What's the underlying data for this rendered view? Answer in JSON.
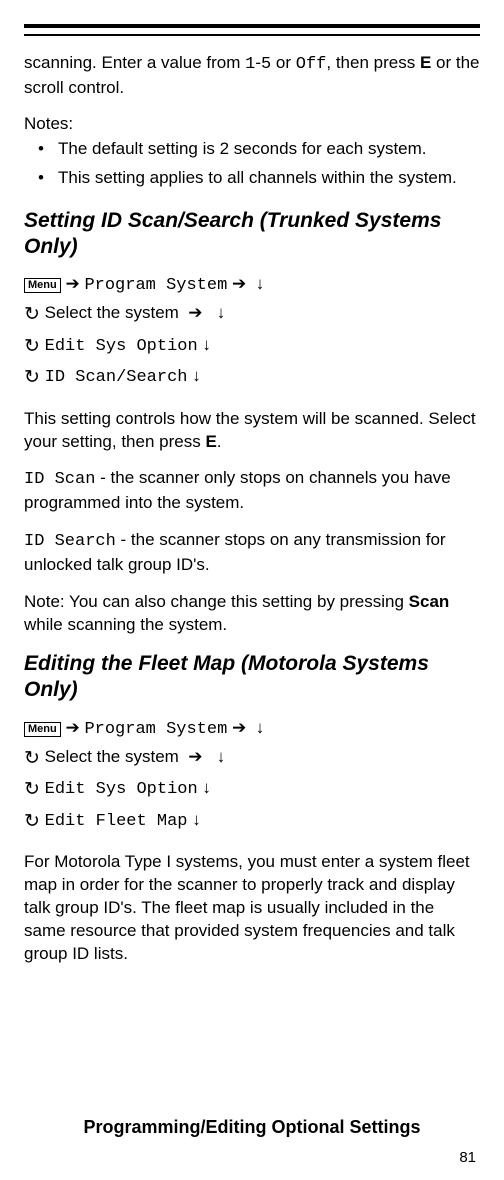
{
  "intro": {
    "p1_a": "scanning. Enter a value from ",
    "p1_code1": "1",
    "p1_b": "-",
    "p1_code2": "5",
    "p1_c": " or ",
    "p1_code3": "Off",
    "p1_d": ", then press ",
    "p1_bold": "E",
    "p1_e": " or the scroll control."
  },
  "notes": {
    "label": "Notes:",
    "items": [
      "The default setting is 2 seconds for each system.",
      "This setting applies to all channels within the system."
    ]
  },
  "section1": {
    "title": "Setting ID Scan/Search (Trunked Systems Only)",
    "nav": {
      "menu": "Menu",
      "line1_code": "Program System",
      "line2_text": "Select the system",
      "line3_code": "Edit Sys Option",
      "line4_code": "ID Scan/Search"
    },
    "p1_a": "This setting controls how the system will be scanned. Select your setting, then press ",
    "p1_bold": "E",
    "p1_b": ".",
    "p2_code": "ID Scan",
    "p2_a": " - the scanner only stops on channels you have programmed into the system.",
    "p3_code": "ID Search",
    "p3_a": " - the scanner stops on any transmission for unlocked talk group ID's.",
    "p4_a": "Note: You can also change this setting by pressing ",
    "p4_bold": "Scan",
    "p4_b": " while scanning the system."
  },
  "section2": {
    "title": "Editing the Fleet Map (Motorola Systems Only)",
    "nav": {
      "menu": "Menu",
      "line1_code": "Program System",
      "line2_text": "Select the system",
      "line3_code": "Edit Sys Option",
      "line4_code": "Edit Fleet Map"
    },
    "p1": "For Motorola Type I systems, you must enter a system fleet map in order for the scanner to properly track and display talk group ID's. The fleet map is usually included in the same resource that provided system frequencies and talk group ID lists."
  },
  "footer": {
    "title": "Programming/Editing Optional Settings",
    "page": "81"
  },
  "glyphs": {
    "right": "➔",
    "down": "↓",
    "scroll": "↻"
  }
}
